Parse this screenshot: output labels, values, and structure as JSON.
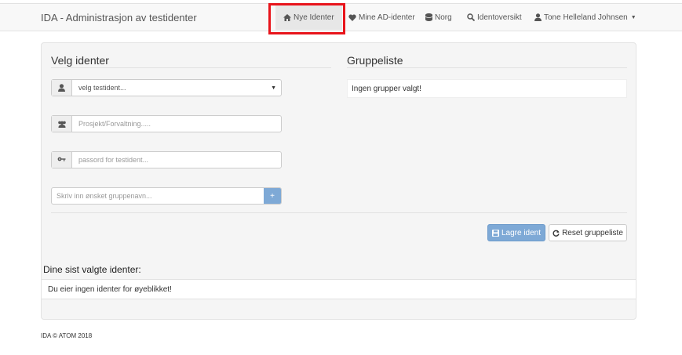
{
  "navbar": {
    "brand": "IDA - Administrasjon av testidenter",
    "items": [
      {
        "label": "Nye Identer",
        "icon": "home-icon",
        "active": true
      },
      {
        "label": "Mine AD-identer",
        "icon": "heart-icon"
      },
      {
        "label": "Norg",
        "icon": "database-icon"
      },
      {
        "label": "Identoversikt",
        "icon": "search-icon"
      },
      {
        "label": "Tone Helleland Johnsen",
        "icon": "user-icon",
        "dropdown": true
      }
    ]
  },
  "velg": {
    "title": "Velg identer",
    "testident_select": "velg testident...",
    "prosjekt_placeholder": "Prosjekt/Forvaltning.....",
    "passord_placeholder": "passord for testident...",
    "gruppenavn_placeholder": "Skriv inn ønsket gruppenavn...",
    "add_label": "+"
  },
  "gruppe": {
    "title": "Gruppeliste",
    "empty": "Ingen grupper valgt!"
  },
  "actions": {
    "save_label": "Lagre ident",
    "reset_label": "Reset gruppeliste"
  },
  "recent": {
    "title": "Dine sist valgte identer:",
    "empty": "Du eier ingen identer for øyeblikket!"
  },
  "footer": "IDA © ATOM 2018",
  "colors": {
    "primary": "#7ea9d6",
    "highlight": "#e8141b"
  }
}
